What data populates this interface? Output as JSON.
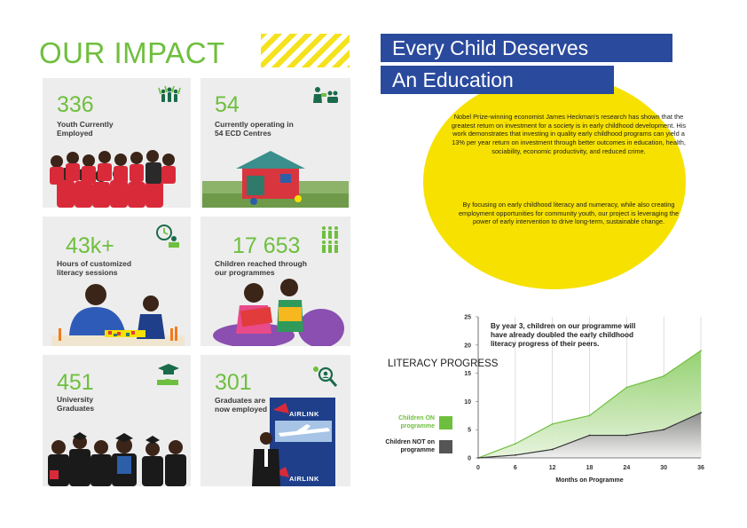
{
  "page_title": "OUR IMPACT",
  "stats": [
    {
      "value": "336",
      "label": "Youth Currently Employed",
      "icon": "people-celebrating-icon"
    },
    {
      "value": "54",
      "label": "Currently operating in 54 ECD Centres",
      "icon": "teacher-children-icon"
    },
    {
      "value": "43k+",
      "label": "Hours of customized literacy sessions",
      "icon": "clock-reading-icon"
    },
    {
      "value": "17 653",
      "label": "Children reached through our programmes",
      "icon": "children-group-icon"
    },
    {
      "value": "451",
      "label": "University Graduates",
      "icon": "graduation-hand-icon"
    },
    {
      "value": "301",
      "label": "Graduates are now employed",
      "icon": "person-search-icon"
    }
  ],
  "photo_caption_airlink": "AIRLINK",
  "hero": {
    "line1": "Every Child Deserves",
    "line2": "An Education"
  },
  "body": {
    "p1": "Nobel Prize-winning economist James Heckman's research has shown that the greatest return on investment for a society is in early childhood development. His work demonstrates that investing in quality early childhood programs can yield a 13% per year return on investment through better outcomes in education, health, sociability, economic productivity, and reduced crime.",
    "p2": "By focusing on early childhood literacy and numeracy, while also creating employment opportunities for community youth, our project is leveraging the power of early intervention to drive long-term, sustainable change."
  },
  "colors": {
    "green": "#6fbf3e",
    "blue": "#2a4a9d",
    "yellow": "#f6e100",
    "card": "#ededed",
    "dark_series": "#555555"
  },
  "chart_data": {
    "type": "area",
    "title": "LITERACY PROGRESS",
    "annotation": "By year 3, children on our programme will have already doubled the early childhood literacy progress of their peers.",
    "xlabel": "Months on Programme",
    "ylabel": "",
    "x": [
      0,
      6,
      12,
      18,
      24,
      30,
      36
    ],
    "xlim": [
      0,
      36
    ],
    "ylim": [
      0,
      25
    ],
    "yticks": [
      0,
      5,
      10,
      15,
      20,
      25
    ],
    "series": [
      {
        "name": "Children ON programme",
        "color": "#6fbf3e",
        "values": [
          0,
          2.5,
          6,
          7.5,
          12.5,
          14.5,
          19
        ]
      },
      {
        "name": "Children NOT on programme",
        "color": "#555555",
        "values": [
          0,
          0.5,
          1.5,
          4,
          4,
          5,
          8
        ]
      }
    ],
    "grid": "vertical",
    "legend": "left"
  }
}
